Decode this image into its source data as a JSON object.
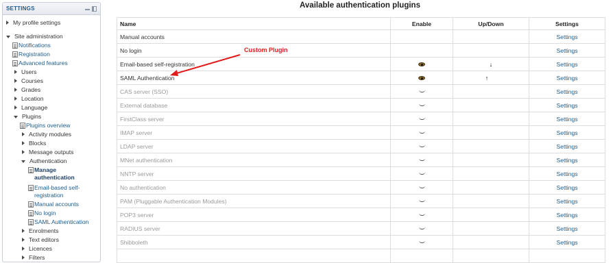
{
  "sidebar": {
    "title": "SETTINGS",
    "profile": "My profile settings",
    "site_admin": "Site administration",
    "notifications": "Notifications",
    "registration": "Registration",
    "advanced": "Advanced features",
    "users": "Users",
    "courses": "Courses",
    "grades": "Grades",
    "location": "Location",
    "language": "Language",
    "plugins": "Plugins",
    "plugins_overview": "Plugins overview",
    "activity_modules": "Activity modules",
    "blocks": "Blocks",
    "message_outputs": "Message outputs",
    "authentication": "Authentication",
    "manage_auth": "Manage authentication",
    "email_self": "Email-based self-registration",
    "manual": "Manual accounts",
    "nologin": "No login",
    "saml": "SAML Authentication",
    "enrolments": "Enrolments",
    "text_editors": "Text editors",
    "licences": "Licences",
    "filters": "Filters"
  },
  "main": {
    "title": "Available authentication plugins",
    "headers": {
      "name": "Name",
      "enable": "Enable",
      "updown": "Up/Down",
      "settings": "Settings"
    },
    "rows": [
      {
        "name": "Manual accounts",
        "enabled_state": "none",
        "updown": "",
        "settings": "Settings"
      },
      {
        "name": "No login",
        "enabled_state": "none",
        "updown": "",
        "settings": "Settings"
      },
      {
        "name": "Email-based self-registration",
        "enabled_state": "shown",
        "updown": "↓",
        "settings": "Settings"
      },
      {
        "name": "SAML Authentication",
        "enabled_state": "shown",
        "updown": "↑",
        "settings": "Settings"
      },
      {
        "name": "CAS server (SSO)",
        "enabled_state": "hidden",
        "updown": "",
        "settings": "Settings"
      },
      {
        "name": "External database",
        "enabled_state": "hidden",
        "updown": "",
        "settings": "Settings"
      },
      {
        "name": "FirstClass server",
        "enabled_state": "hidden",
        "updown": "",
        "settings": "Settings"
      },
      {
        "name": "IMAP server",
        "enabled_state": "hidden",
        "updown": "",
        "settings": "Settings"
      },
      {
        "name": "LDAP server",
        "enabled_state": "hidden",
        "updown": "",
        "settings": "Settings"
      },
      {
        "name": "MNet authentication",
        "enabled_state": "hidden",
        "updown": "",
        "settings": "Settings"
      },
      {
        "name": "NNTP server",
        "enabled_state": "hidden",
        "updown": "",
        "settings": "Settings"
      },
      {
        "name": "No authentication",
        "enabled_state": "hidden",
        "updown": "",
        "settings": "Settings"
      },
      {
        "name": "PAM (Pluggable Authentication Modules)",
        "enabled_state": "hidden",
        "updown": "",
        "settings": "Settings"
      },
      {
        "name": "POP3 server",
        "enabled_state": "hidden",
        "updown": "",
        "settings": "Settings"
      },
      {
        "name": "RADIUS server",
        "enabled_state": "hidden",
        "updown": "",
        "settings": "Settings"
      },
      {
        "name": "Shibboleth",
        "enabled_state": "hidden",
        "updown": "",
        "settings": "Settings"
      },
      {
        "name": "",
        "enabled_state": "none",
        "updown": "",
        "settings": ""
      }
    ],
    "annotation": "Custom Plugin"
  },
  "colors": {
    "link": "#1d5d90",
    "annotation": "#e21a1a",
    "disabled_text": "#9a9a9a"
  },
  "icons": {
    "shown": "eye-icon",
    "hidden": "eye-closed-icon",
    "up": "arrow-up-icon",
    "down": "arrow-down-icon"
  }
}
